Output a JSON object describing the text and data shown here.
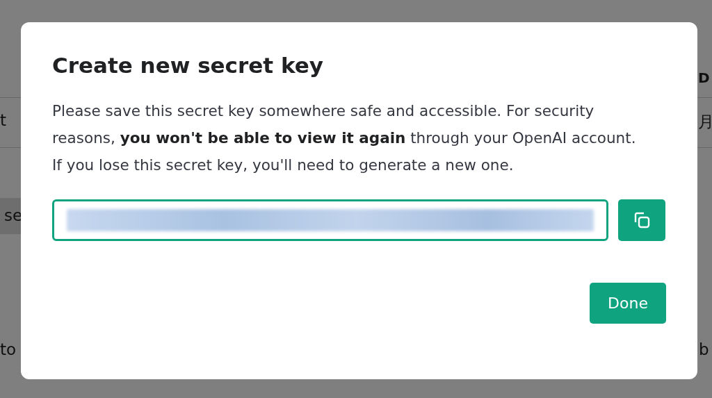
{
  "background": {
    "fragments": [
      {
        "text": "D",
        "kind": "heading"
      },
      {
        "text": "t",
        "kind": "plain"
      },
      {
        "text": "月",
        "kind": "plain"
      },
      {
        "text": "se",
        "kind": "chip"
      },
      {
        "text": "to",
        "kind": "plain"
      },
      {
        "text": "b",
        "kind": "plain"
      }
    ]
  },
  "dialog": {
    "title": "Create new secret key",
    "message": "Please save this secret key somewhere safe and accessible. For security reasons, **you won't be able to view it again** through your OpenAI account. If you lose this secret key, you'll need to generate a new one.",
    "key_field": {
      "blurred": true
    },
    "done_button": "Done"
  }
}
